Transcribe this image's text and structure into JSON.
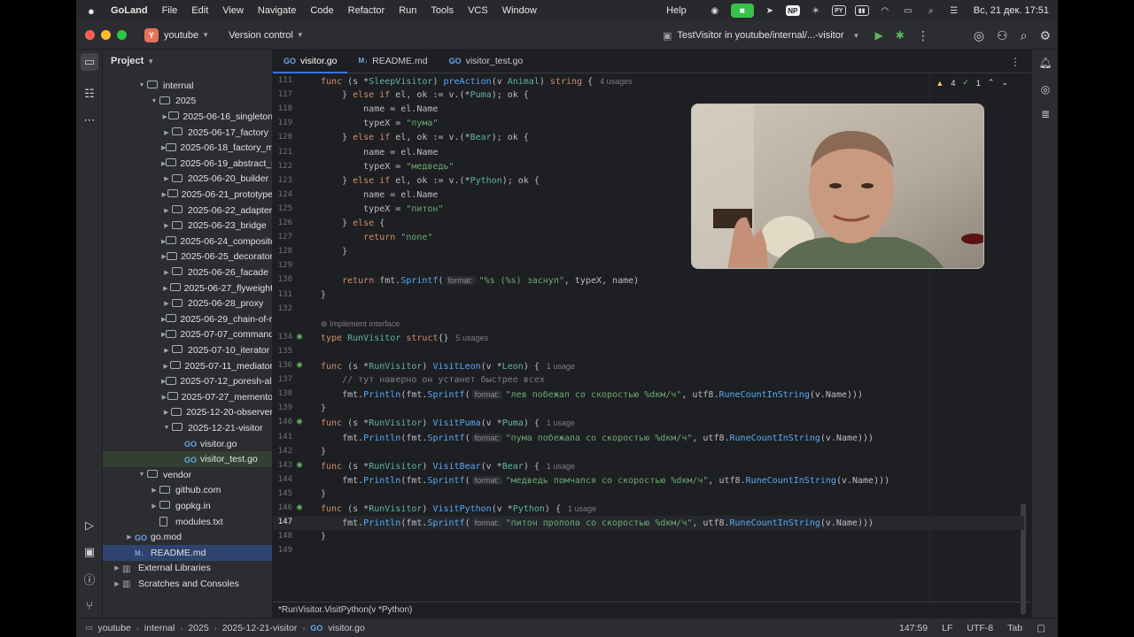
{
  "menubar": {
    "app": "GoLand",
    "items": [
      "File",
      "Edit",
      "View",
      "Navigate",
      "Code",
      "Refactor",
      "Run",
      "Tools",
      "VCS",
      "Window"
    ],
    "help": "Help",
    "datetime": "Вс, 21 дек.  17:51",
    "np_badge": "NP"
  },
  "titlebar": {
    "project_badge": "Y",
    "project": "youtube",
    "vcs": "Version control",
    "run_config": "TestVisitor in youtube/internal/...-visitor"
  },
  "project_panel": {
    "title": "Project",
    "tree": [
      {
        "label": "internal",
        "type": "folder",
        "depth": 1,
        "open": true
      },
      {
        "label": "2025",
        "type": "folder",
        "depth": 2,
        "open": true
      },
      {
        "label": "2025-06-16_singleton",
        "type": "folder",
        "depth": 3
      },
      {
        "label": "2025-06-17_factory",
        "type": "folder",
        "depth": 3
      },
      {
        "label": "2025-06-18_factory_method",
        "type": "folder",
        "depth": 3
      },
      {
        "label": "2025-06-19_abstract_method",
        "type": "folder",
        "depth": 3
      },
      {
        "label": "2025-06-20_builder",
        "type": "folder",
        "depth": 3
      },
      {
        "label": "2025-06-21_prototype",
        "type": "folder",
        "depth": 3
      },
      {
        "label": "2025-06-22_adapter",
        "type": "folder",
        "depth": 3
      },
      {
        "label": "2025-06-23_bridge",
        "type": "folder",
        "depth": 3
      },
      {
        "label": "2025-06-24_composite",
        "type": "folder",
        "depth": 3
      },
      {
        "label": "2025-06-25_decorator",
        "type": "folder",
        "depth": 3
      },
      {
        "label": "2025-06-26_facade",
        "type": "folder",
        "depth": 3
      },
      {
        "label": "2025-06-27_flyweight",
        "type": "folder",
        "depth": 3
      },
      {
        "label": "2025-06-28_proxy",
        "type": "folder",
        "depth": 3
      },
      {
        "label": "2025-06-29_chain-of-responsibility",
        "type": "folder",
        "depth": 3
      },
      {
        "label": "2025-07-07_command",
        "type": "folder",
        "depth": 3
      },
      {
        "label": "2025-07-10_iterator",
        "type": "folder",
        "depth": 3
      },
      {
        "label": "2025-07-11_mediator",
        "type": "folder",
        "depth": 3
      },
      {
        "label": "2025-07-12_poresh-algo",
        "type": "folder",
        "depth": 3
      },
      {
        "label": "2025-07-27_memento",
        "type": "folder",
        "depth": 3
      },
      {
        "label": "2025-12-20-observer",
        "type": "folder",
        "depth": 3
      },
      {
        "label": "2025-12-21-visitor",
        "type": "folder",
        "depth": 3,
        "open": true
      },
      {
        "label": "visitor.go",
        "type": "go",
        "depth": 4
      },
      {
        "label": "visitor_test.go",
        "type": "go",
        "depth": 4,
        "highlight": true
      },
      {
        "label": "vendor",
        "type": "folder",
        "depth": 1,
        "open": true
      },
      {
        "label": "github.com",
        "type": "folder",
        "depth": 2
      },
      {
        "label": "gopkg.in",
        "type": "folder",
        "depth": 2
      },
      {
        "label": "modules.txt",
        "type": "txt",
        "depth": 2,
        "leaf": true
      },
      {
        "label": "go.mod",
        "type": "go",
        "depth": 0
      },
      {
        "label": "README.md",
        "type": "md",
        "depth": 0,
        "selected": true,
        "leaf": true
      },
      {
        "label": "External Libraries",
        "type": "lib",
        "depth": -1
      },
      {
        "label": "Scratches and Consoles",
        "type": "lib",
        "depth": -1
      }
    ]
  },
  "tabs": [
    {
      "label": "visitor.go",
      "icon": "go",
      "active": true
    },
    {
      "label": "README.md",
      "icon": "md"
    },
    {
      "label": "visitor_test.go",
      "icon": "go"
    }
  ],
  "inspections": {
    "warnings": "4",
    "ok": "1"
  },
  "code_lines": [
    {
      "n": "111",
      "html": "<span class=\"kw\">func</span> (s *<span class=\"ty\">SleepVisitor</span>) <span class=\"fn\">preAction</span>(v <span class=\"ty\">Animal</span>) <span class=\"kw\">string</span> {<span class=\"hint\">4 usages</span>"
    },
    {
      "n": "117",
      "html": "    } <span class=\"kw\">else if</span> el, ok := v.(*<span class=\"ty\">Puma</span>); ok {"
    },
    {
      "n": "118",
      "html": "        name = el.Name"
    },
    {
      "n": "119",
      "html": "        typeX = <span class=\"str\">\"пума\"</span>"
    },
    {
      "n": "120",
      "html": "    } <span class=\"kw\">else if</span> el, ok := v.(*<span class=\"ty\">Bear</span>); ok {"
    },
    {
      "n": "121",
      "html": "        name = el.Name"
    },
    {
      "n": "122",
      "html": "        typeX = <span class=\"str\">\"медведь\"</span>"
    },
    {
      "n": "123",
      "html": "    } <span class=\"kw\">else if</span> el, ok := v.(*<span class=\"ty\">Python</span>); ok {"
    },
    {
      "n": "124",
      "html": "        name = el.Name"
    },
    {
      "n": "125",
      "html": "        typeX = <span class=\"str\">\"питон\"</span>"
    },
    {
      "n": "126",
      "html": "    } <span class=\"kw\">else</span> {"
    },
    {
      "n": "127",
      "html": "        <span class=\"kw\">return</span> <span class=\"str\">\"none\"</span>"
    },
    {
      "n": "128",
      "html": "    }"
    },
    {
      "n": "129",
      "html": ""
    },
    {
      "n": "130",
      "html": "    <span class=\"kw\">return</span> fmt.<span class=\"fn\">Sprintf</span>(<span class=\"inlay\">format:</span><span class=\"str\">\"%s (%s) заснул\"</span>, typeX, name)"
    },
    {
      "n": "131",
      "html": "}"
    },
    {
      "n": "132",
      "html": ""
    },
    {
      "n": "",
      "html": "<span class=\"implnote\">⊕ Implement interface</span>",
      "small": true
    },
    {
      "n": "134",
      "icon": "impl",
      "html": "<span class=\"kw\">type</span> <span class=\"ty\">RunVisitor</span> <span class=\"kw\">struct</span>{}<span class=\"hint\">5 usages</span>"
    },
    {
      "n": "135",
      "html": ""
    },
    {
      "n": "136",
      "icon": "impl",
      "html": "<span class=\"kw\">func</span> (s *<span class=\"ty\">RunVisitor</span>) <span class=\"fn\">VisitLeon</span>(v *<span class=\"ty\">Leon</span>) {<span class=\"hint\">1 usage</span>"
    },
    {
      "n": "137",
      "html": "    <span class=\"cm\">// тут наверно он устанет быстрее всех</span>"
    },
    {
      "n": "138",
      "html": "    fmt.<span class=\"fn\">Println</span>(fmt.<span class=\"fn\">Sprintf</span>(<span class=\"inlay\">format:</span><span class=\"str\">\"лев побежал со скоростью %dкм/ч\"</span>, utf8.<span class=\"fn\">RuneCountInString</span>(v.Name)))"
    },
    {
      "n": "139",
      "html": "}"
    },
    {
      "n": "140",
      "icon": "impl",
      "html": "<span class=\"kw\">func</span> (s *<span class=\"ty\">RunVisitor</span>) <span class=\"fn\">VisitPuma</span>(v *<span class=\"ty\">Puma</span>) {<span class=\"hint\">1 usage</span>"
    },
    {
      "n": "141",
      "html": "    fmt.<span class=\"fn\">Println</span>(fmt.<span class=\"fn\">Sprintf</span>(<span class=\"inlay\">format:</span><span class=\"str\">\"пума побежала со скоростью %dкм/ч\"</span>, utf8.<span class=\"fn\">RuneCountInString</span>(v.Name)))"
    },
    {
      "n": "142",
      "html": "}"
    },
    {
      "n": "143",
      "icon": "impl",
      "html": "<span class=\"kw\">func</span> (s *<span class=\"ty\">RunVisitor</span>) <span class=\"fn\">VisitBear</span>(v *<span class=\"ty\">Bear</span>) {<span class=\"hint\">1 usage</span>"
    },
    {
      "n": "144",
      "html": "    fmt.<span class=\"fn\">Println</span>(fmt.<span class=\"fn\">Sprintf</span>(<span class=\"inlay\">format:</span><span class=\"str\">\"медведь помчался со скоростью %dкм/ч\"</span>, utf8.<span class=\"fn\">RuneCountInString</span>(v.Name)))"
    },
    {
      "n": "145",
      "html": "}"
    },
    {
      "n": "146",
      "icon": "impl",
      "html": "<span class=\"kw\">func</span> (s *<span class=\"ty\">RunVisitor</span>) <span class=\"fn\">VisitPython</span>(v *<span class=\"ty\">Python</span>) {<span class=\"hint\">1 usage</span>"
    },
    {
      "n": "147",
      "current": true,
      "html": "    fmt.<span class=\"fn\">Println</span>(fmt.<span class=\"fn\">Sprintf</span>(<span class=\"inlay\">format:</span><span class=\"str\">\"питон пропола со скоростью %dкм/ч\"</span>, utf8.<span class=\"fn\">RuneCountInString</span>(v.Name)))"
    },
    {
      "n": "148",
      "html": "}"
    },
    {
      "n": "149",
      "html": ""
    }
  ],
  "editor_status": "*RunVisitor.VisitPython(v *Python)",
  "breadcrumbs": [
    "youtube",
    "internal",
    "2025",
    "2025-12-21-visitor",
    "visitor.go"
  ],
  "statusbar": {
    "position": "147:59",
    "line_sep": "LF",
    "encoding": "UTF-8",
    "indent": "Tab"
  }
}
